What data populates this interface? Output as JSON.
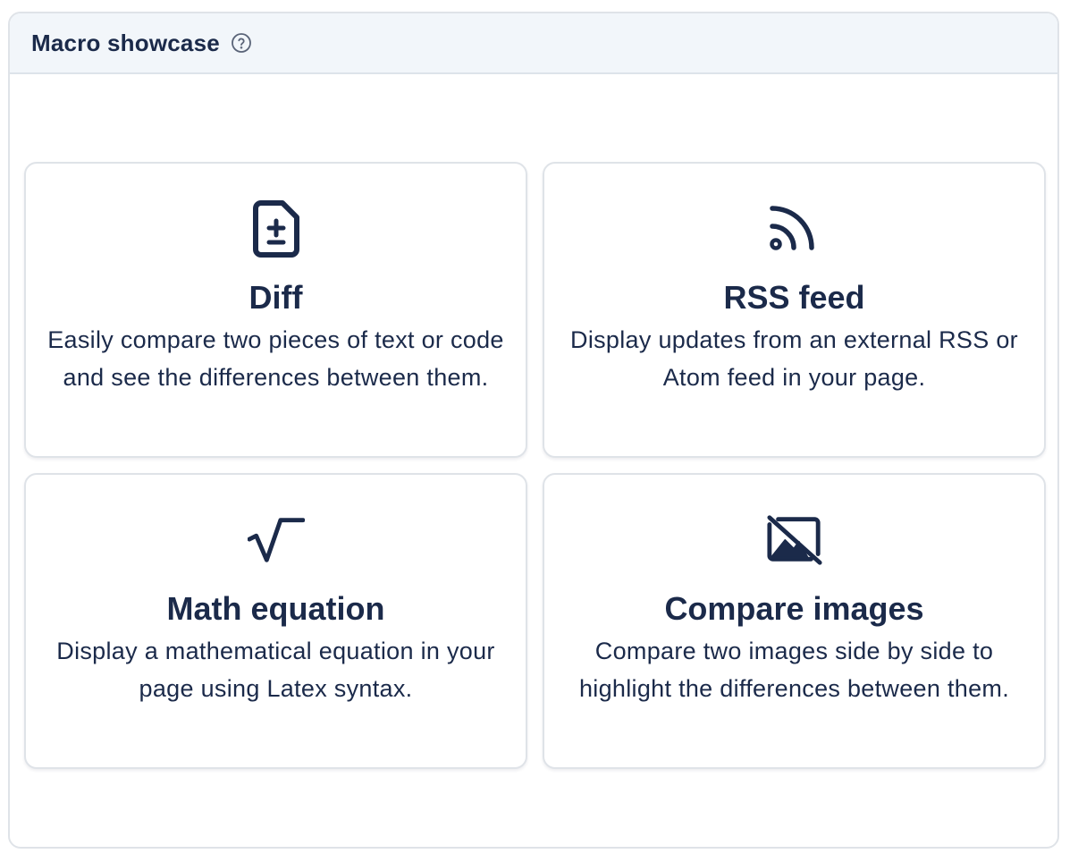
{
  "panel": {
    "title": "Macro showcase",
    "help_icon": "question-circle-icon"
  },
  "cards": [
    {
      "title": "Diff",
      "description": "Easily compare two pieces of text or code and see the differences between them.",
      "icon": "file-diff-icon"
    },
    {
      "title": "RSS feed",
      "description": "Display updates from an external RSS or Atom feed in your page.",
      "icon": "rss-icon"
    },
    {
      "title": "Math equation",
      "description": "Display a mathematical equation in your page using Latex syntax.",
      "icon": "square-root-icon"
    },
    {
      "title": "Compare images",
      "description": "Compare two images side by side to highlight the differences between them.",
      "icon": "image-off-icon"
    }
  ],
  "colors": {
    "text": "#1b2a4a",
    "header_bg": "#f2f6fa",
    "border": "#dfe3e8"
  }
}
